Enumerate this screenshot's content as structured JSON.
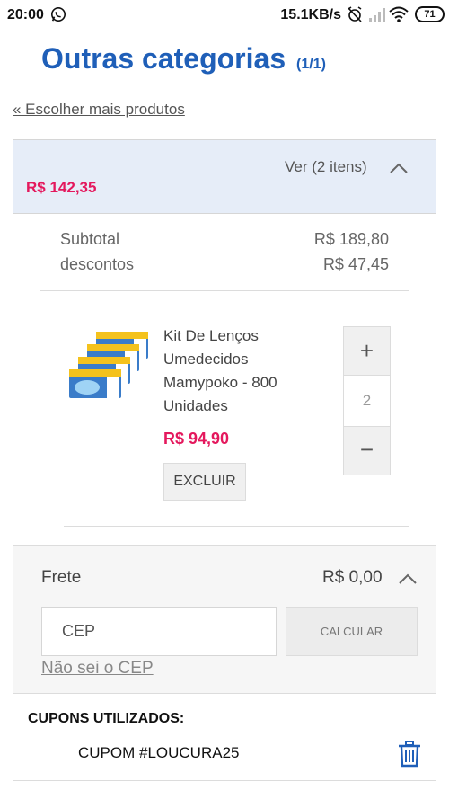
{
  "status_bar": {
    "time": "20:00",
    "network_speed": "15.1KB/s",
    "battery": "71",
    "icons": [
      "whatsapp-icon",
      "alarm-off-icon",
      "signal-icon",
      "wifi-icon"
    ]
  },
  "header": {
    "title": "Outras categorias",
    "count": "(1/1)",
    "back_link": "« Escolher mais produtos"
  },
  "cart": {
    "total": "R$ 142,35",
    "view_label": "Ver (2 itens)",
    "subtotal_label": "Subtotal",
    "subtotal_value": "R$ 189,80",
    "discount_label": "descontos",
    "discount_value": "R$ 47,45",
    "item": {
      "name": "Kit De Lenços Umedecidos Mamypoko - 800 Unidades",
      "price": "R$ 94,90",
      "remove_label": "EXCLUIR",
      "quantity": "2",
      "plus_label": "+",
      "minus_label": "−"
    }
  },
  "shipping": {
    "label": "Frete",
    "value": "R$ 0,00",
    "cep_placeholder": "CEP",
    "calculate_label": "CALCULAR",
    "unknown_cep_link": "Não sei o CEP"
  },
  "coupons": {
    "title": "CUPONS UTILIZADOS:",
    "code": "CUPOM #LOUCURA25"
  },
  "colors": {
    "brand_blue": "#1f5fb8",
    "price_pink": "#e4185d",
    "header_bg": "#e6edf8"
  }
}
